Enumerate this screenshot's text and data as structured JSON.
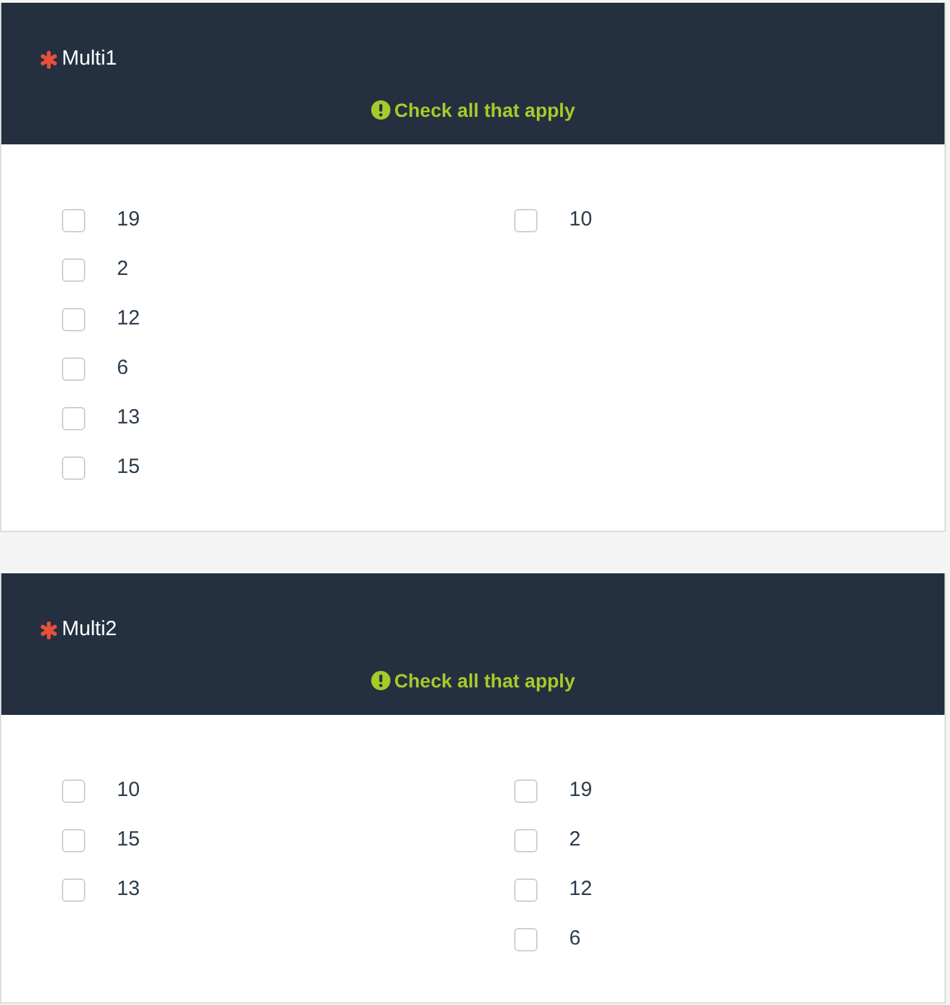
{
  "questions": [
    {
      "title": "Multi1",
      "required": true,
      "hint": "Check all that apply",
      "columns": [
        [
          {
            "label": "19",
            "checked": false
          },
          {
            "label": "2",
            "checked": false
          },
          {
            "label": "12",
            "checked": false
          },
          {
            "label": "6",
            "checked": false
          },
          {
            "label": "13",
            "checked": false
          },
          {
            "label": "15",
            "checked": false
          }
        ],
        [
          {
            "label": "10",
            "checked": false
          }
        ]
      ]
    },
    {
      "title": "Multi2",
      "required": true,
      "hint": "Check all that apply",
      "columns": [
        [
          {
            "label": "10",
            "checked": false
          },
          {
            "label": "15",
            "checked": false
          },
          {
            "label": "13",
            "checked": false
          }
        ],
        [
          {
            "label": "19",
            "checked": false
          },
          {
            "label": "2",
            "checked": false
          },
          {
            "label": "12",
            "checked": false
          },
          {
            "label": "6",
            "checked": false
          }
        ]
      ]
    }
  ]
}
